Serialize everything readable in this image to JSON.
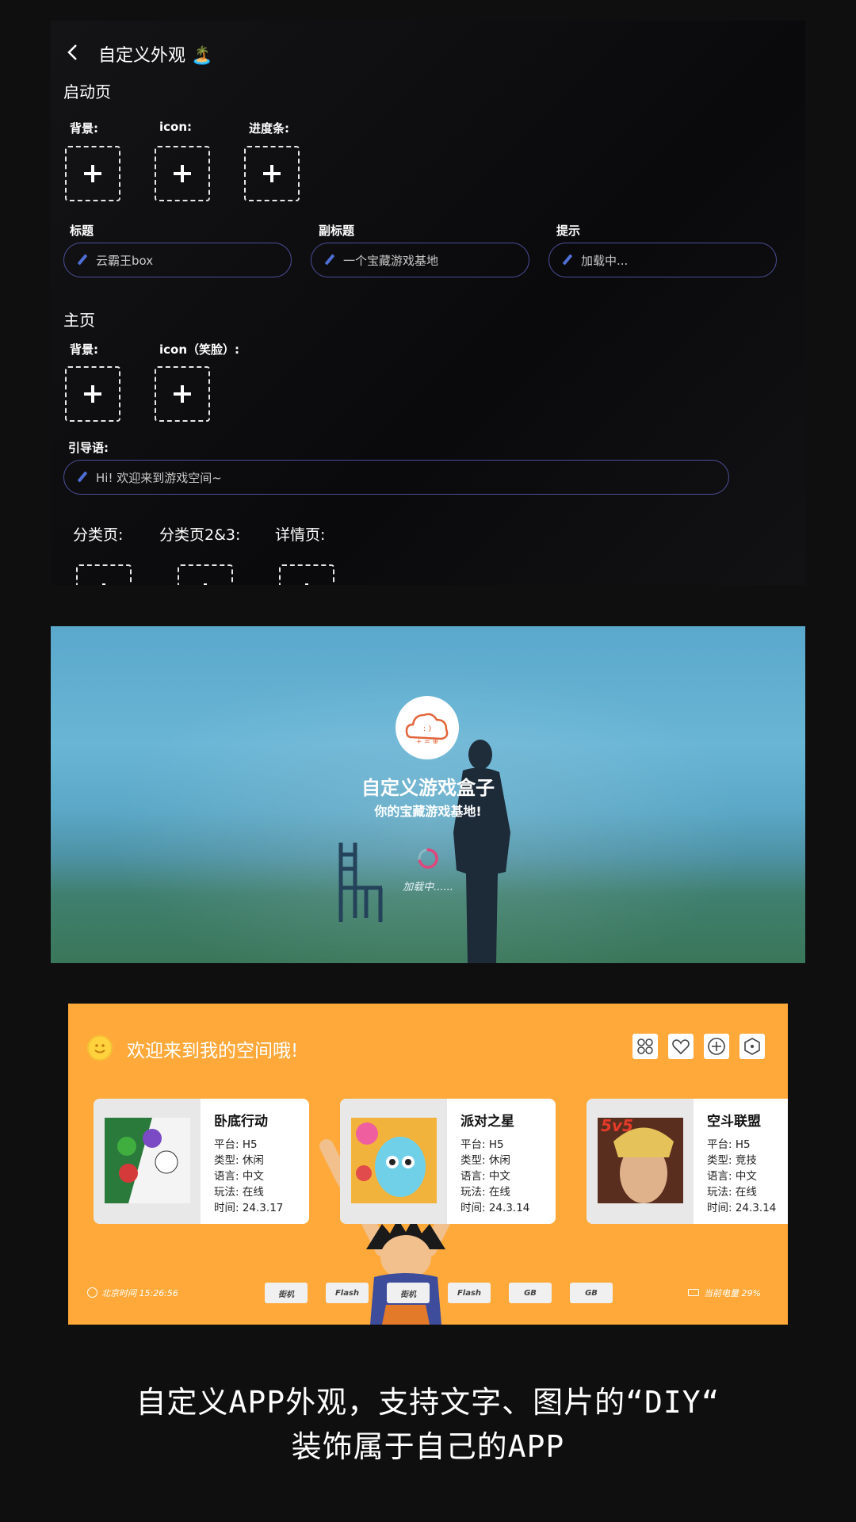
{
  "settings": {
    "header_title": "自定义外观 🏝️",
    "launch_section": "启动页",
    "launch_bg_label": "背景:",
    "launch_icon_label": "icon:",
    "launch_progress_label": "进度条:",
    "title_label": "标题",
    "title_value": "云霸王box",
    "subtitle_label": "副标题",
    "subtitle_value": "一个宝藏游戏基地",
    "hint_label": "提示",
    "hint_value": "加载中...",
    "home_section": "主页",
    "home_bg_label": "背景:",
    "home_icon_label": "icon（笑脸）:",
    "guide_label": "引导语:",
    "guide_value": "Hi!  欢迎来到游戏空间~",
    "category_label": "分类页:",
    "category23_label": "分类页2&3:",
    "detail_label": "详情页:"
  },
  "splash": {
    "title": "自定义游戏盒子",
    "subtitle": "你的宝藏游戏基地!",
    "loading": "加载中......"
  },
  "home": {
    "welcome": "欢迎来到我的空间哦!",
    "cards": [
      {
        "title": "卧底行动",
        "platform": "平台:  H5",
        "type": "类型:  休闲",
        "lang": "语言:  中文",
        "mode": "玩法:  在线",
        "time": "时间:  24.3.17"
      },
      {
        "title": "派对之星",
        "platform": "平台:  H5",
        "type": "类型:  休闲",
        "lang": "语言:  中文",
        "mode": "玩法:  在线",
        "time": "时间:  24.3.14"
      },
      {
        "title": "空斗联盟",
        "platform": "平台:  H5",
        "type": "类型:  竞技",
        "lang": "语言:  中文",
        "mode": "玩法:  在线",
        "time": "时间:  24.3.14"
      }
    ],
    "clock": "北京时间  15:26:56",
    "battery": "当前电量  29%",
    "tags": [
      "街机",
      "Flash",
      "街机",
      "Flash",
      "GB",
      "GB"
    ],
    "game3_badge": "5v5"
  },
  "caption": {
    "line1": "自定义APP外观，支持文字、图片的“DIY“",
    "line2": "装饰属于自己的APP"
  },
  "colors": {
    "panel3_bg": "#ffa93a",
    "pill_border": "#4b4f99",
    "spinner": "#e0457b"
  }
}
